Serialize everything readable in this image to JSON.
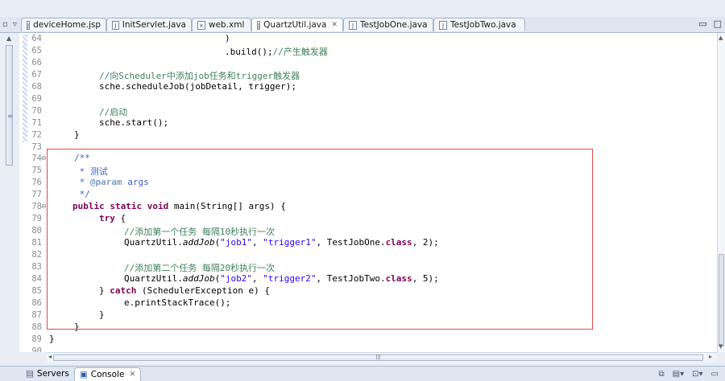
{
  "editor_tabs": [
    {
      "label": "deviceHome.jsp",
      "active": false,
      "icon": "jsp-file-icon"
    },
    {
      "label": "InitServlet.java",
      "active": false,
      "icon": "java-file-icon"
    },
    {
      "label": "web.xml",
      "active": false,
      "icon": "xml-file-icon"
    },
    {
      "label": "QuartzUtil.java",
      "active": true,
      "icon": "java-file-icon"
    },
    {
      "label": "TestJobOne.java",
      "active": false,
      "icon": "java-file-icon"
    },
    {
      "label": "TestJobTwo.java",
      "active": false,
      "icon": "java-file-icon"
    }
  ],
  "line_numbers": [
    "64",
    "65",
    "66",
    "67",
    "68",
    "69",
    "70",
    "71",
    "72",
    "73",
    "74",
    "75",
    "76",
    "77",
    "78",
    "79",
    "80",
    "81",
    "82",
    "83",
    "84",
    "85",
    "86",
    "87",
    "88",
    "89",
    "90"
  ],
  "code": {
    "l64": ")",
    "l65a": ".build();",
    "l65b": "//产生触发器",
    "l67": "//向Scheduler中添加job任务和trigger触发器",
    "l68": "sche.scheduleJob(jobDetail, trigger);",
    "l70": "//启动",
    "l71": "sche.start();",
    "l72": "}",
    "l74": "/**",
    "l75": " * 测试",
    "l76a": " * ",
    "l76b": "@param",
    "l76c": " args",
    "l77": " */",
    "l78a": "public static void",
    "l78b": " main(String[] args) {",
    "l79": "try",
    "l79b": " {",
    "l80": "//添加第一个任务 每隔10秒执行一次",
    "l81a": "QuartzUtil.",
    "l81b": "addJob",
    "l81c": "(",
    "l81d": "\"job1\"",
    "l81e": ", ",
    "l81f": "\"trigger1\"",
    "l81g": ", TestJobOne.",
    "l81h": "class",
    "l81i": ", 2);",
    "l83": "//添加第二个任务 每隔20秒执行一次",
    "l84a": "QuartzUtil.",
    "l84b": "addJob",
    "l84c": "(",
    "l84d": "\"job2\"",
    "l84e": ", ",
    "l84f": "\"trigger2\"",
    "l84g": ", TestJobTwo.",
    "l84h": "class",
    "l84i": ", 5);",
    "l85a": "} ",
    "l85b": "catch",
    "l85c": " (SchedulerException e) {",
    "l86": "e.printStackTrace();",
    "l87": "}",
    "l88": "}",
    "l89": "}"
  },
  "bottom_tabs": [
    {
      "label": "Servers",
      "active": false,
      "icon": "servers-icon"
    },
    {
      "label": "Console",
      "active": true,
      "icon": "console-icon"
    }
  ],
  "colors": {
    "comment": "#3f7f5f",
    "keyword": "#7f0055",
    "string": "#2a00ff",
    "javadoc": "#3f5fbf",
    "highlight_box": "#e04848"
  }
}
